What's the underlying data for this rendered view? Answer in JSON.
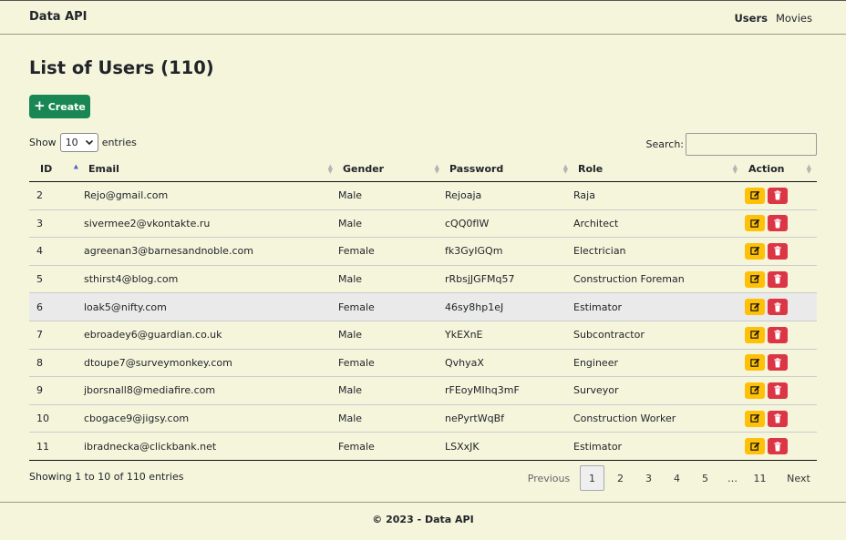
{
  "navbar": {
    "brand": "Data API",
    "links": [
      {
        "label": "Users"
      },
      {
        "label": "Movies"
      }
    ]
  },
  "page": {
    "title": "List of Users (110)",
    "create_label": "Create"
  },
  "length_menu": {
    "show": "Show",
    "value": "10",
    "entries": "entries"
  },
  "search": {
    "label": "Search:",
    "value": ""
  },
  "table": {
    "columns": [
      "ID",
      "Email",
      "Gender",
      "Password",
      "Role",
      "Action"
    ],
    "sorted_column": "ID",
    "rows": [
      {
        "id": "2",
        "email": "Rejo@gmail.com",
        "gender": "Male",
        "password": "Rejoaja",
        "role": "Raja"
      },
      {
        "id": "3",
        "email": "sivermee2@vkontakte.ru",
        "gender": "Male",
        "password": "cQQ0fIW",
        "role": "Architect"
      },
      {
        "id": "4",
        "email": "agreenan3@barnesandnoble.com",
        "gender": "Female",
        "password": "fk3GyIGQm",
        "role": "Electrician"
      },
      {
        "id": "5",
        "email": "sthirst4@blog.com",
        "gender": "Male",
        "password": "rRbsjJGFMq57",
        "role": "Construction Foreman"
      },
      {
        "id": "6",
        "email": "loak5@nifty.com",
        "gender": "Female",
        "password": "46sy8hp1eJ",
        "role": "Estimator"
      },
      {
        "id": "7",
        "email": "ebroadey6@guardian.co.uk",
        "gender": "Male",
        "password": "YkEXnE",
        "role": "Subcontractor"
      },
      {
        "id": "8",
        "email": "dtoupe7@surveymonkey.com",
        "gender": "Female",
        "password": "QvhyaX",
        "role": "Engineer"
      },
      {
        "id": "9",
        "email": "jborsnall8@mediafire.com",
        "gender": "Male",
        "password": "rFEoyMIhq3mF",
        "role": "Surveyor"
      },
      {
        "id": "10",
        "email": "cbogace9@jigsy.com",
        "gender": "Male",
        "password": "nePyrtWqBf",
        "role": "Construction Worker"
      },
      {
        "id": "11",
        "email": "ibradnecka@clickbank.net",
        "gender": "Female",
        "password": "LSXxJK",
        "role": "Estimator"
      }
    ]
  },
  "info": "Showing 1 to 10 of 110 entries",
  "pagination": {
    "previous": "Previous",
    "pages": [
      "1",
      "2",
      "3",
      "4",
      "5"
    ],
    "ellipsis": "…",
    "last": "11",
    "next": "Next",
    "current": "1"
  },
  "footer": "© 2023 - Data API",
  "colors": {
    "background": "#f5f5dc",
    "create": "#198754",
    "edit": "#ffc107",
    "delete": "#dc3545"
  }
}
